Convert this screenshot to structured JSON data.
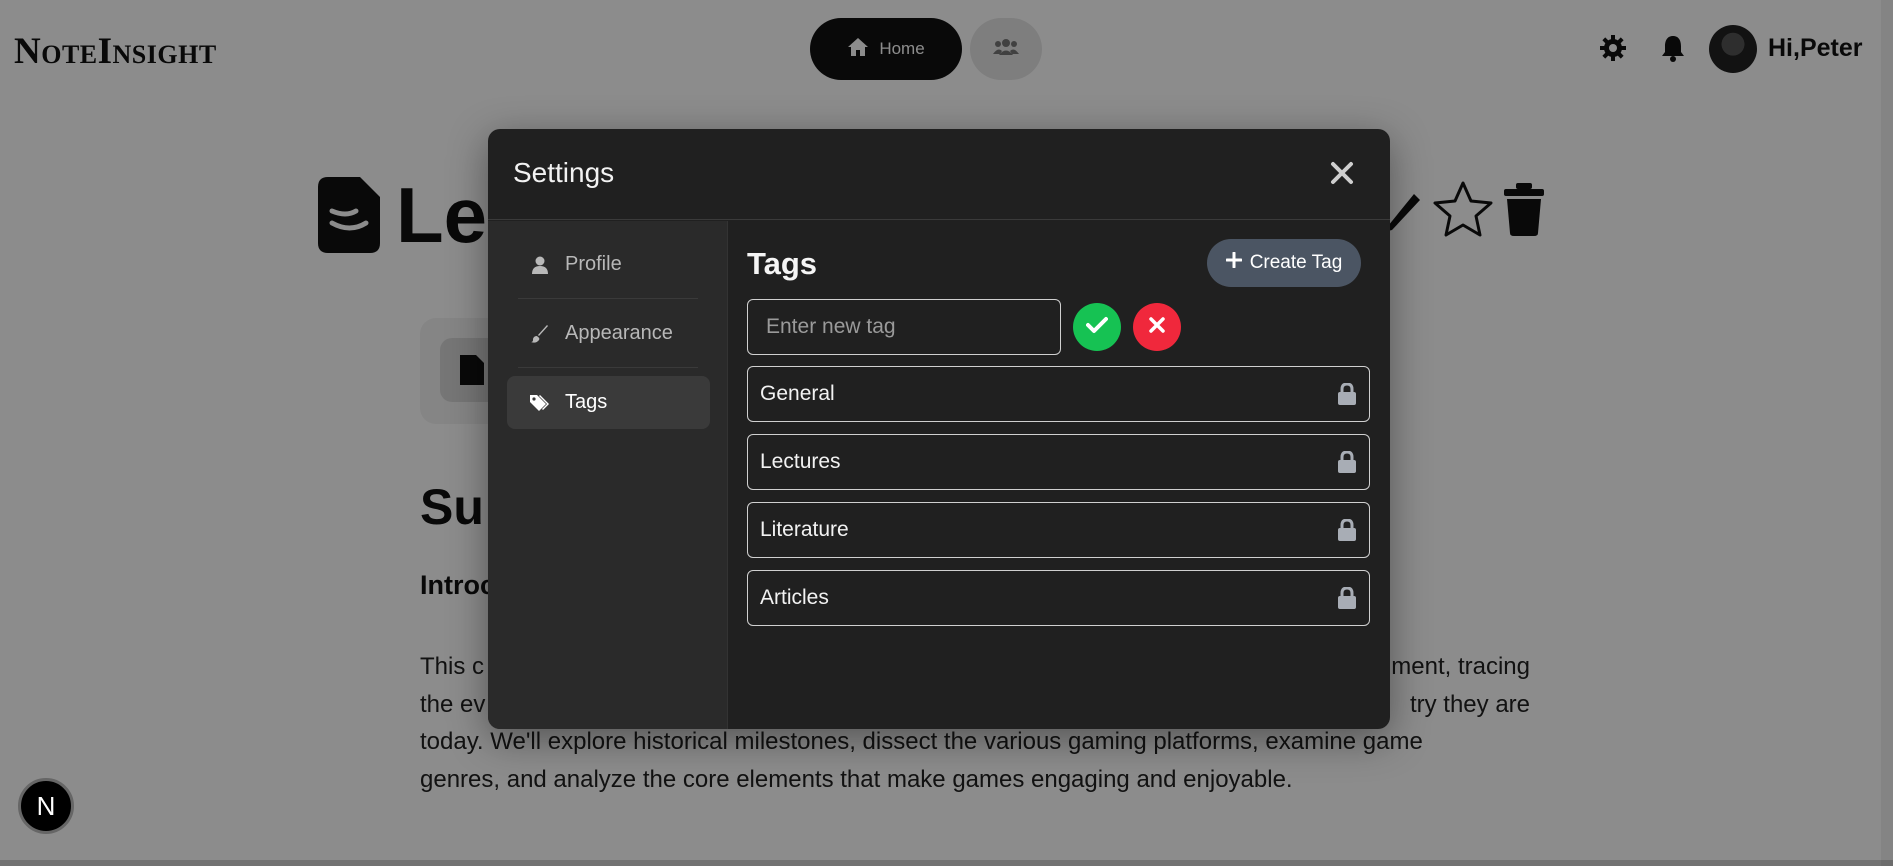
{
  "app": {
    "logo": "NoteInsight"
  },
  "nav": {
    "home_label": "Home"
  },
  "user": {
    "greeting": "Hi,Peter"
  },
  "note": {
    "title_visible": "Lec",
    "section_heading_visible": "Su",
    "subsection_heading_visible": "Introc",
    "paragraph_lines": [
      "This c",
      "ment, tracing",
      "the ev",
      "try they are",
      "today. We'll explore historical milestones, dissect the various gaming platforms, examine game",
      "genres, and analyze the core elements that make games engaging and enjoyable."
    ]
  },
  "settings": {
    "title": "Settings",
    "sidebar": [
      {
        "label": "Profile",
        "icon": "user-icon"
      },
      {
        "label": "Appearance",
        "icon": "brush-icon"
      },
      {
        "label": "Tags",
        "icon": "tags-icon"
      }
    ],
    "active_tab": "Tags",
    "tags_panel": {
      "heading": "Tags",
      "create_label": "Create Tag",
      "input_placeholder": "Enter new tag",
      "tags": [
        {
          "name": "General",
          "locked": true
        },
        {
          "name": "Lectures",
          "locked": true
        },
        {
          "name": "Literature",
          "locked": true
        },
        {
          "name": "Articles",
          "locked": true
        }
      ]
    }
  },
  "badge": {
    "letter": "N"
  },
  "colors": {
    "confirm": "#16c253",
    "cancel": "#f0283c",
    "create_button": "#4b5563",
    "modal_bg": "#202020"
  }
}
